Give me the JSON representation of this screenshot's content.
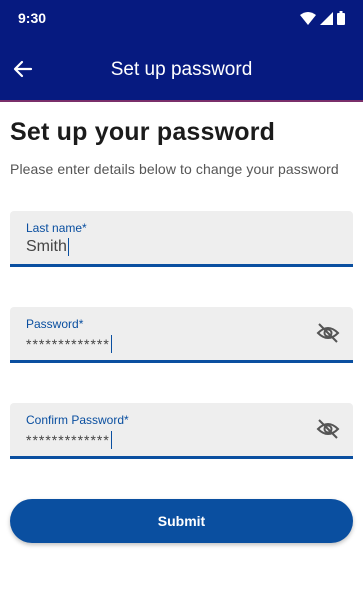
{
  "status_bar": {
    "time": "9:30",
    "icons": [
      "wifi-icon",
      "signal-icon",
      "battery-icon"
    ]
  },
  "header": {
    "title": "Set up password",
    "back_icon": "arrow-left-icon"
  },
  "content": {
    "heading": "Set up your password",
    "subtitle": "Please enter details below to change your password"
  },
  "form": {
    "last_name": {
      "label": "Last name*",
      "value": "Smith"
    },
    "password": {
      "label": "Password*",
      "value": "*************",
      "toggle_icon": "eye-off-icon"
    },
    "confirm_password": {
      "label": "Confirm Password*",
      "value": "*************",
      "toggle_icon": "eye-off-icon"
    },
    "submit_label": "Submit"
  },
  "colors": {
    "header_bg": "#061a80",
    "accent": "#0a4fa0",
    "field_bg": "#eeeeee"
  }
}
